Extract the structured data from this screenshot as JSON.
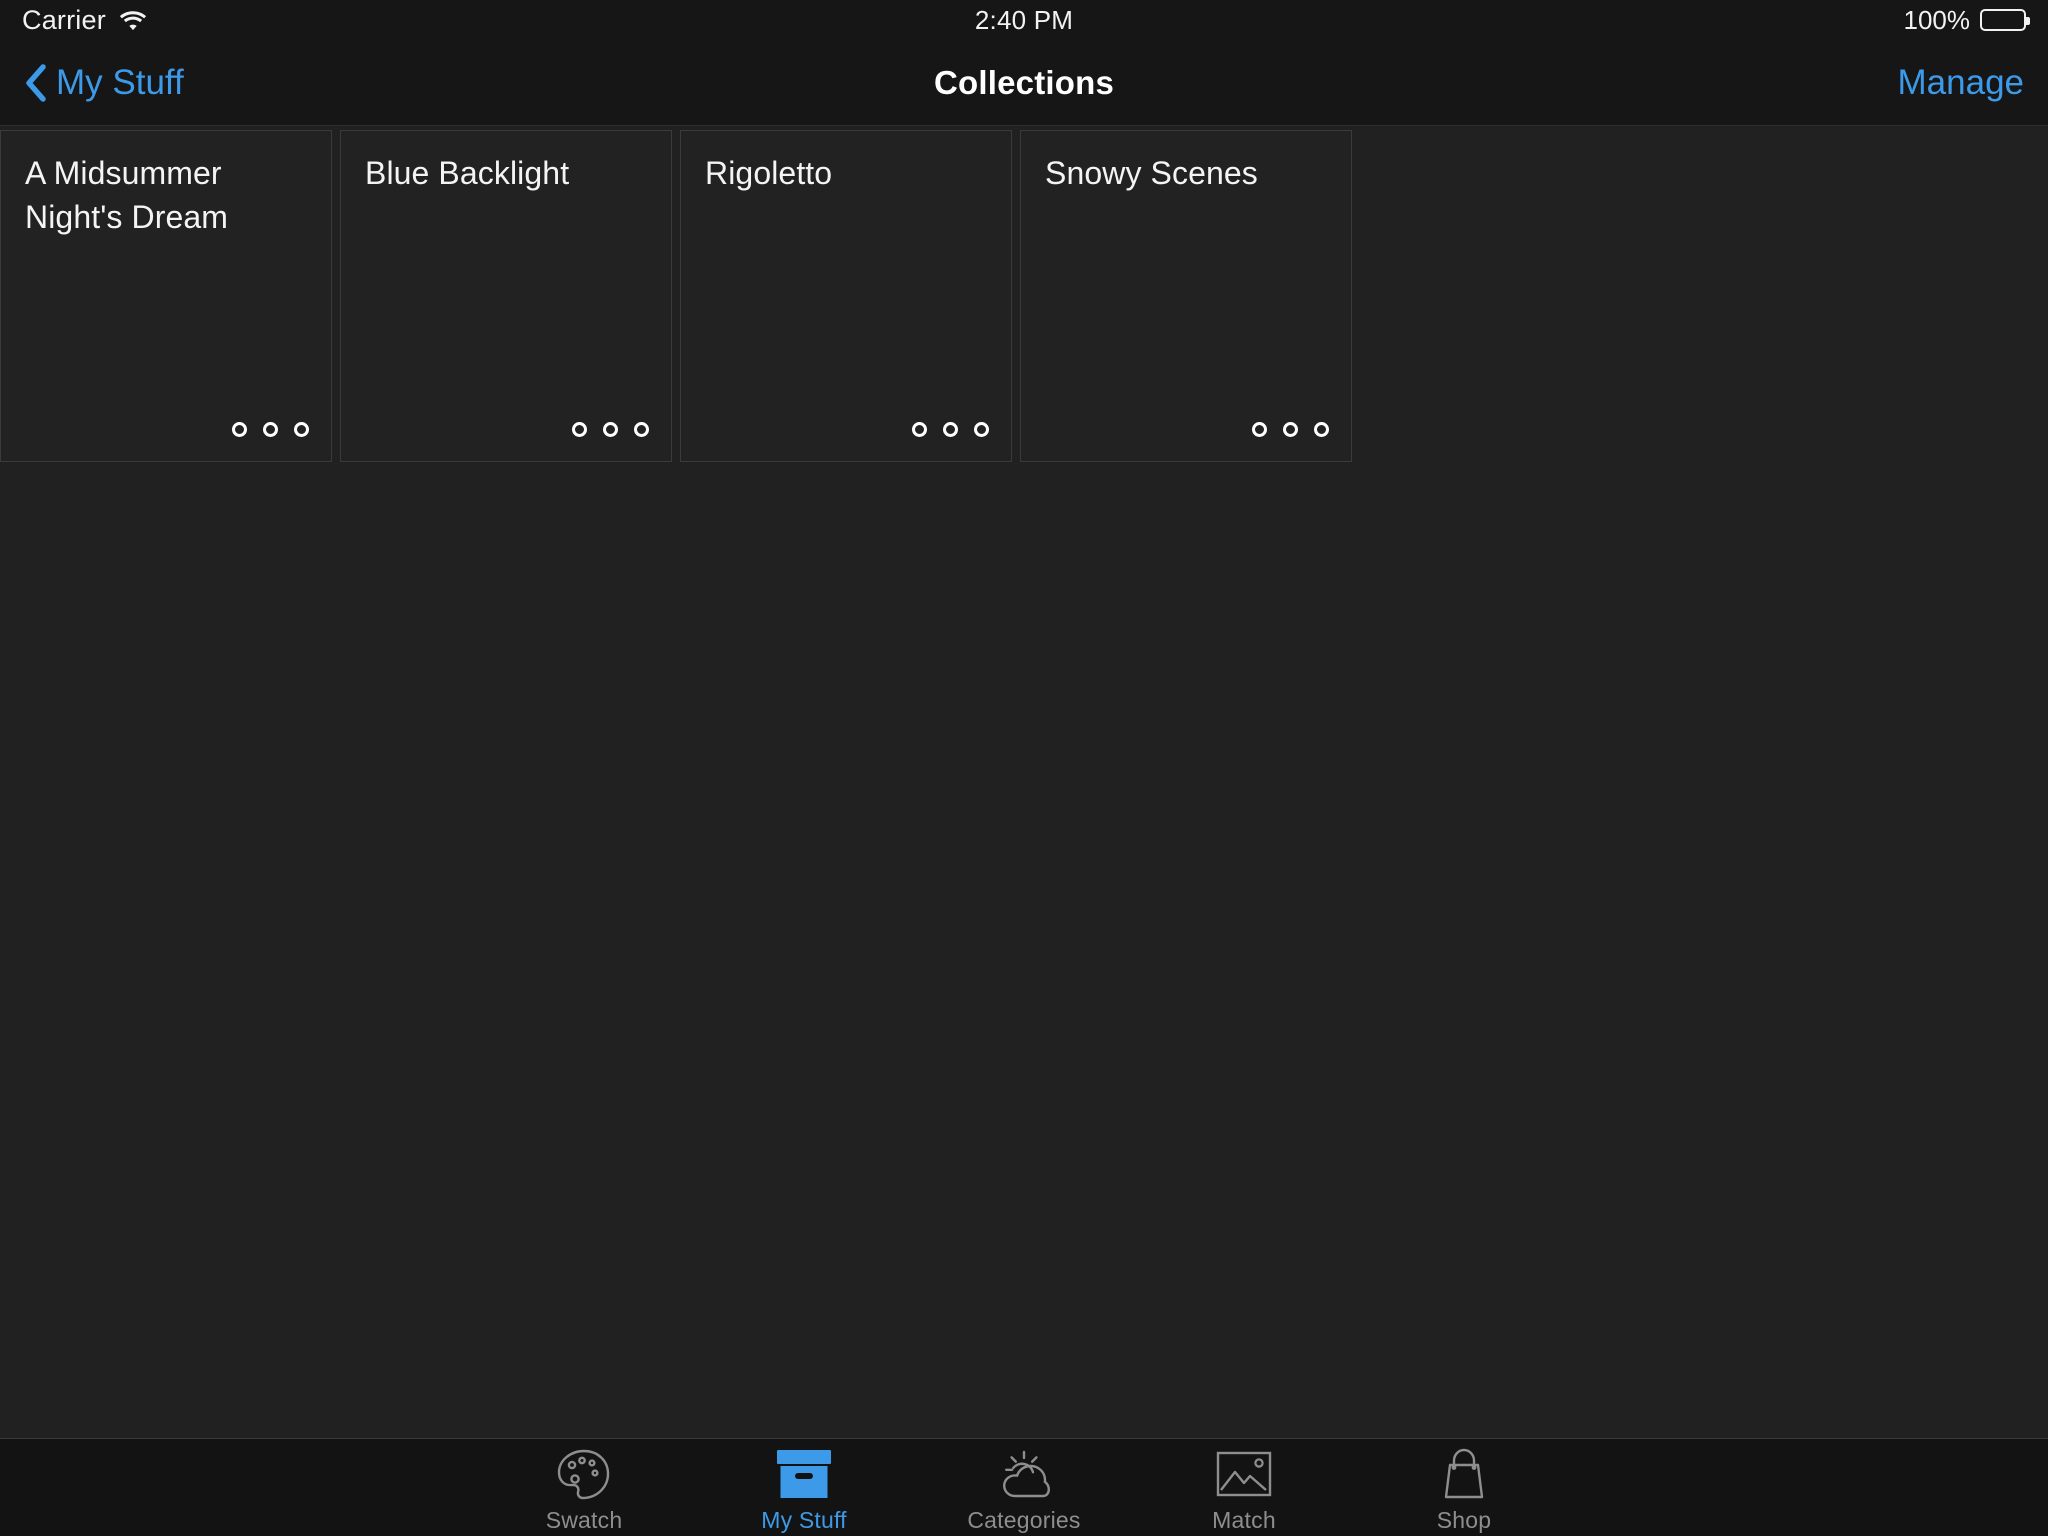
{
  "status_bar": {
    "carrier": "Carrier",
    "wifi_icon": "wifi-icon",
    "time": "2:40 PM",
    "battery_percent": "100%",
    "battery_icon": "battery-full-icon",
    "battery_level": 100
  },
  "nav_bar": {
    "back_icon": "chevron-left-icon",
    "back_label": "My Stuff",
    "title": "Collections",
    "right_action": "Manage",
    "accent_color": "#3d9ae8"
  },
  "collections": [
    {
      "title": "A Midsummer Night's Dream",
      "more_icon": "three-circles-icon"
    },
    {
      "title": "Blue Backlight",
      "more_icon": "three-circles-icon"
    },
    {
      "title": "Rigoletto",
      "more_icon": "three-circles-icon"
    },
    {
      "title": "Snowy Scenes",
      "more_icon": "three-circles-icon"
    }
  ],
  "tab_bar": {
    "items": [
      {
        "label": "Swatch",
        "icon": "palette-icon",
        "active": false
      },
      {
        "label": "My Stuff",
        "icon": "box-icon",
        "active": true
      },
      {
        "label": "Categories",
        "icon": "sun-cloud-icon",
        "active": false
      },
      {
        "label": "Match",
        "icon": "photo-icon",
        "active": false
      },
      {
        "label": "Shop",
        "icon": "shopping-bag-icon",
        "active": false
      }
    ],
    "active_color": "#3d9ae8",
    "inactive_color": "#8e8e8e"
  }
}
